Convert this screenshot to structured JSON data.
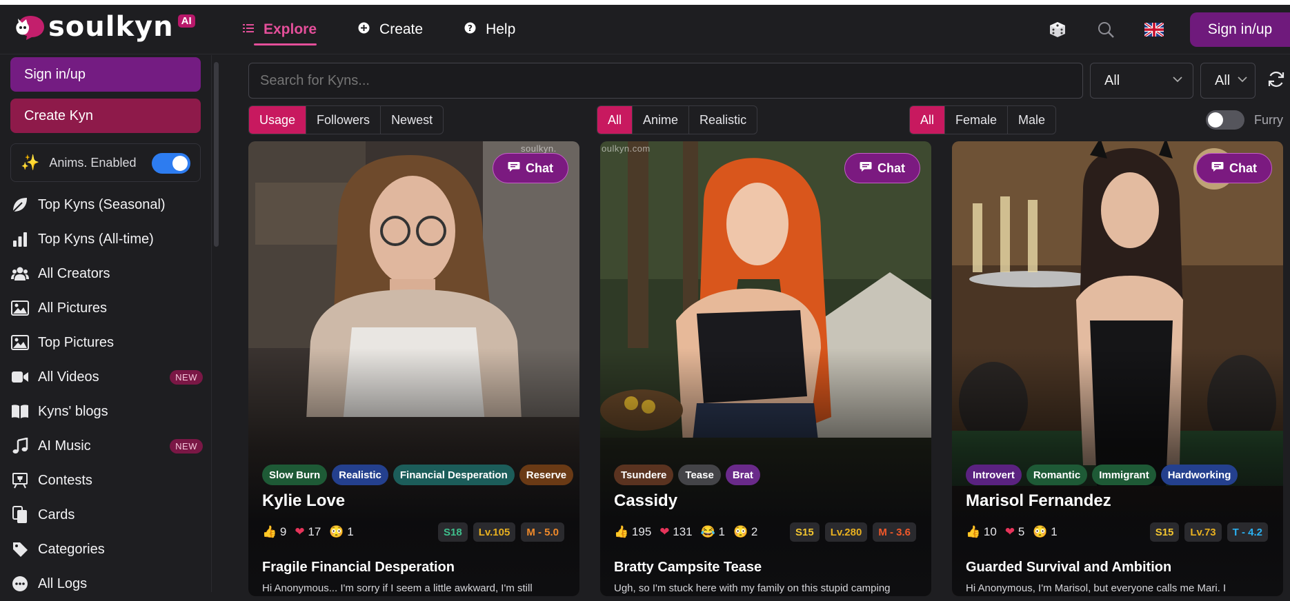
{
  "header": {
    "logo_text": "soulkyn",
    "logo_badge": "AI",
    "nav": [
      {
        "label": "Explore",
        "icon": "menu-lines-icon",
        "active": true
      },
      {
        "label": "Create",
        "icon": "plus-circle-icon",
        "active": false
      },
      {
        "label": "Help",
        "icon": "question-circle-icon",
        "active": false
      }
    ],
    "right_icons": [
      "dice-icon",
      "search-icon",
      "uk-flag-icon"
    ],
    "signin_label": "Sign in/up"
  },
  "sidebar": {
    "signin_label": "Sign in/up",
    "create_label": "Create Kyn",
    "anims_label": "Anims. Enabled",
    "anims_enabled": true,
    "items": [
      {
        "label": "Top Kyns (Seasonal)",
        "icon": "leaf-icon"
      },
      {
        "label": "Top Kyns (All-time)",
        "icon": "bar-chart-icon"
      },
      {
        "label": "All Creators",
        "icon": "users-icon"
      },
      {
        "label": "All Pictures",
        "icon": "image-icon"
      },
      {
        "label": "Top Pictures",
        "icon": "image-icon"
      },
      {
        "label": "All Videos",
        "icon": "video-icon",
        "badge": "NEW"
      },
      {
        "label": "Kyns' blogs",
        "icon": "book-icon"
      },
      {
        "label": "AI Music",
        "icon": "music-icon",
        "badge": "NEW"
      },
      {
        "label": "Contests",
        "icon": "trophy-board-icon"
      },
      {
        "label": "Cards",
        "icon": "cards-icon"
      },
      {
        "label": "Categories",
        "icon": "tag-icon"
      },
      {
        "label": "All Logs",
        "icon": "logs-icon"
      }
    ]
  },
  "filters": {
    "search_placeholder": "Search for Kyns...",
    "select1": "All",
    "select2": "All",
    "sort": [
      "Usage",
      "Followers",
      "Newest"
    ],
    "sort_active": 0,
    "style": [
      "All",
      "Anime",
      "Realistic"
    ],
    "style_active": 0,
    "gender": [
      "All",
      "Female",
      "Male"
    ],
    "gender_active": 0,
    "furry_label": "Furry",
    "furry_enabled": false
  },
  "cards": [
    {
      "name": "Kylie Love",
      "chat_label": "Chat",
      "watermark": "soulkyn.",
      "tags": [
        {
          "label": "Slow Burn",
          "color": "#1e5a36"
        },
        {
          "label": "Realistic",
          "color": "#24408e"
        },
        {
          "label": "Financial Desperation",
          "color": "#1c5d5a"
        },
        {
          "label": "Reserve",
          "color": "#6a3a15"
        }
      ],
      "stats": [
        {
          "icon": "thumbs-up-icon",
          "glyph": "👍",
          "value": "9"
        },
        {
          "icon": "heart-icon",
          "glyph": "❤",
          "value": "17"
        },
        {
          "icon": "flushed-face-icon",
          "glyph": "😳",
          "value": "1"
        }
      ],
      "pills": [
        {
          "label": "S18",
          "color": "#3fbf8c"
        },
        {
          "label": "Lv.105",
          "color": "#e8b020"
        },
        {
          "label": "M - 5.0",
          "color": "#f08a2a"
        }
      ],
      "title": "Fragile Financial Desperation",
      "desc": "Hi Anonymous... I'm sorry if I seem a little awkward, I'm still"
    },
    {
      "name": "Cassidy",
      "chat_label": "Chat",
      "watermark": "oulkyn.com",
      "tags": [
        {
          "label": "Tsundere",
          "color": "#5a3320"
        },
        {
          "label": "Tease",
          "color": "#444448"
        },
        {
          "label": "Brat",
          "color": "#6a2a8a"
        }
      ],
      "stats": [
        {
          "icon": "thumbs-up-icon",
          "glyph": "👍",
          "value": "195"
        },
        {
          "icon": "heart-icon",
          "glyph": "❤",
          "value": "131"
        },
        {
          "icon": "laughing-face-icon",
          "glyph": "😂",
          "value": "1"
        },
        {
          "icon": "flushed-face-icon",
          "glyph": "😳",
          "value": "2"
        }
      ],
      "pills": [
        {
          "label": "S15",
          "color": "#f2c530"
        },
        {
          "label": "Lv.280",
          "color": "#e8b020"
        },
        {
          "label": "M - 3.6",
          "color": "#f0582a"
        }
      ],
      "title": "Bratty Campsite Tease",
      "desc": "Ugh, so I'm stuck here with my family on this stupid camping"
    },
    {
      "name": "Marisol Fernandez",
      "chat_label": "Chat",
      "watermark": "",
      "tags": [
        {
          "label": "Introvert",
          "color": "#5a2280"
        },
        {
          "label": "Romantic",
          "color": "#1e5a36"
        },
        {
          "label": "Immigrant",
          "color": "#1e5a36"
        },
        {
          "label": "Hardworking",
          "color": "#24408e"
        }
      ],
      "stats": [
        {
          "icon": "thumbs-up-icon",
          "glyph": "👍",
          "value": "10"
        },
        {
          "icon": "heart-icon",
          "glyph": "❤",
          "value": "5"
        },
        {
          "icon": "flushed-face-icon",
          "glyph": "😳",
          "value": "1"
        }
      ],
      "pills": [
        {
          "label": "S15",
          "color": "#f2c530"
        },
        {
          "label": "Lv.73",
          "color": "#e8b020"
        },
        {
          "label": "T - 4.2",
          "color": "#2ab0f0"
        }
      ],
      "title": "Guarded Survival and Ambition",
      "desc": "Hi Anonymous, I'm Marisol, but everyone calls me Mari. I"
    }
  ]
}
